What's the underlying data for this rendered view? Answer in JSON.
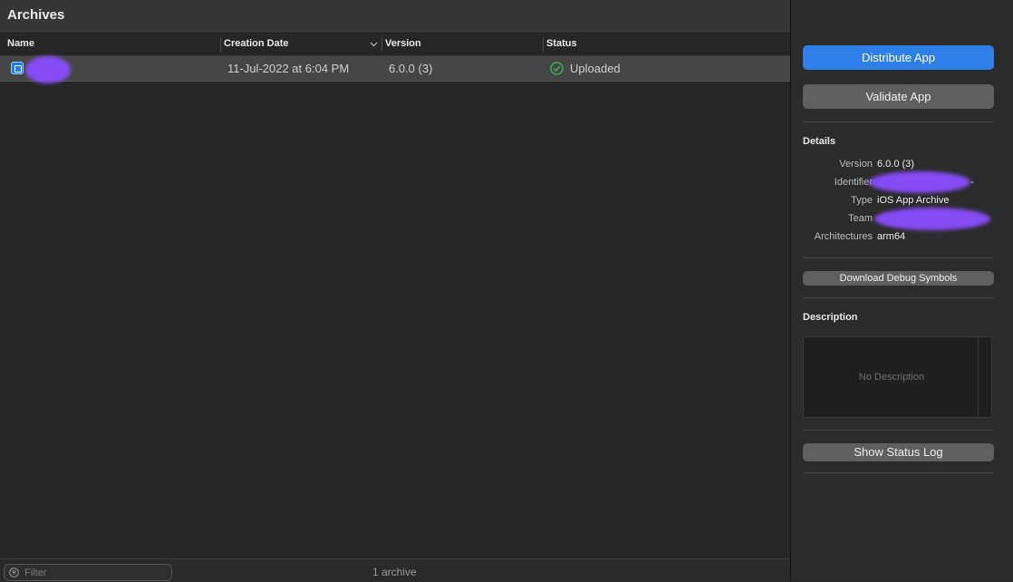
{
  "window": {
    "title": "Archives"
  },
  "table": {
    "columns": {
      "name": "Name",
      "creation_date": "Creation Date",
      "version": "Version",
      "status": "Status"
    },
    "rows": [
      {
        "creation_date": "11-Jul-2022 at 6:04 PM",
        "version": "6.0.0 (3)",
        "status": "Uploaded"
      }
    ]
  },
  "footer": {
    "filter_placeholder": "Filter",
    "count": "1 archive"
  },
  "sidebar": {
    "distribute_label": "Distribute App",
    "validate_label": "Validate App",
    "details_title": "Details",
    "details": {
      "version_label": "Version",
      "version_value": "6.0.0 (3)",
      "identifier_label": "Identifier",
      "identifier_value": "-",
      "type_label": "Type",
      "type_value": "iOS App Archive",
      "team_label": "Team",
      "arch_label": "Architectures",
      "arch_value": "arm64"
    },
    "debug_symbols_label": "Download Debug Symbols",
    "description_title": "Description",
    "description_placeholder": "No Description",
    "status_log_label": "Show Status Log"
  },
  "colors": {
    "accent": "#2f7fe8",
    "success": "#3fb950",
    "redaction": "#8a4dff"
  },
  "icons": {
    "app": "app-icon",
    "status": "checkmark-circle-icon",
    "filter": "filter-icon",
    "sort": "chevron-down-icon"
  }
}
